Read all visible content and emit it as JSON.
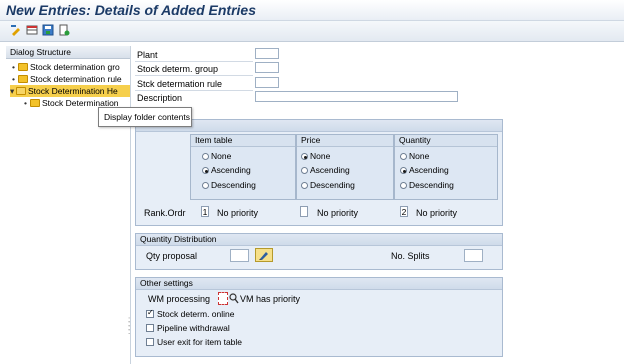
{
  "window": {
    "title": "New Entries: Details of Added Entries"
  },
  "toolbar": {
    "icons": [
      "change-icon",
      "table-icon",
      "save-icon",
      "export-icon"
    ]
  },
  "dialog_structure": {
    "header": "Dialog Structure",
    "items": [
      {
        "label": "Stock determination gro",
        "open": false,
        "selected": false
      },
      {
        "label": "Stock determination rule",
        "open": false,
        "selected": false
      },
      {
        "label": "Stock Determination He",
        "open": true,
        "selected": true
      },
      {
        "label": "Stock Determination",
        "open": false,
        "selected": false
      }
    ]
  },
  "tooltip": "Display folder contents",
  "fields": {
    "plant": {
      "label": "Plant",
      "value": ""
    },
    "group": {
      "label": "Stock determ. group",
      "value": ""
    },
    "rule": {
      "label": "Stck determation rule",
      "value": ""
    },
    "description": {
      "label": "Description",
      "value": ""
    }
  },
  "sort": {
    "columns": [
      {
        "title": "Item table",
        "options": [
          "None",
          "Ascending",
          "Descending"
        ],
        "selected": 1
      },
      {
        "title": "Price",
        "options": [
          "None",
          "Ascending",
          "Descending"
        ],
        "selected": 0
      },
      {
        "title": "Quantity",
        "options": [
          "None",
          "Ascending",
          "Descending"
        ],
        "selected": 1
      }
    ],
    "rank_label": "Rank.Ordr",
    "ranks": [
      {
        "value": "1",
        "priority": "No priority"
      },
      {
        "value": "",
        "priority": "No priority"
      },
      {
        "value": "2",
        "priority": "No priority"
      }
    ]
  },
  "quantity_distribution": {
    "title": "Quantity Distribution",
    "qty_proposal_label": "Qty proposal",
    "qty_proposal_value": "",
    "splits_label": "No. Splits",
    "splits_value": ""
  },
  "other_settings": {
    "title": "Other settings",
    "wm_processing_label": "WM processing",
    "wm_processing_value": "",
    "wm_priority_text": "VM has priority",
    "checkboxes": [
      {
        "label": "Stock determ. online",
        "checked": true
      },
      {
        "label": "Pipeline withdrawal",
        "checked": false
      },
      {
        "label": "User exit for item table",
        "checked": false
      }
    ]
  },
  "colors": {
    "accent": "#1b3a66",
    "selected": "#f6cf4c",
    "group_bg": "#e7eef7"
  }
}
